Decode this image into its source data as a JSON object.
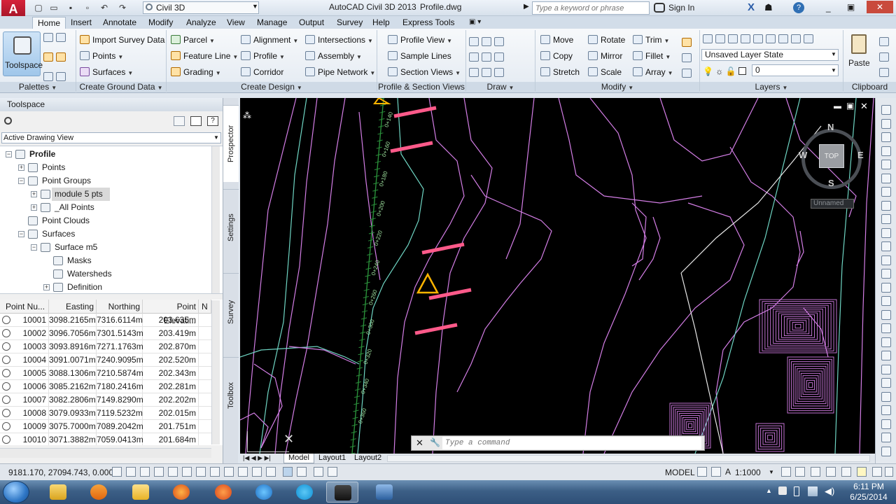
{
  "titlebar": {
    "workspace": "Civil 3D",
    "app_title": "AutoCAD Civil 3D 2013",
    "document": "Profile.dwg",
    "search_placeholder": "Type a keyword or phrase",
    "sign_in": "Sign In"
  },
  "ribbon": {
    "tabs": [
      "Home",
      "Insert",
      "Annotate",
      "Modify",
      "Analyze",
      "View",
      "Manage",
      "Output",
      "Survey",
      "Help",
      "Express Tools"
    ],
    "active_tab": "Home",
    "palettes": {
      "title": "Palettes",
      "toolspace": "Toolspace"
    },
    "ground": {
      "title": "Create Ground Data",
      "import": "Import Survey Data",
      "points": "Points",
      "surfaces": "Surfaces"
    },
    "design": {
      "title": "Create Design",
      "parcel": "Parcel",
      "feature_line": "Feature Line",
      "grading": "Grading",
      "alignment": "Alignment",
      "profile": "Profile",
      "corridor": "Corridor",
      "intersections": "Intersections",
      "assembly": "Assembly",
      "pipe_network": "Pipe Network"
    },
    "profile_section": {
      "title": "Profile & Section Views",
      "profile_view": "Profile View",
      "sample_lines": "Sample Lines",
      "section_views": "Section Views"
    },
    "draw": {
      "title": "Draw"
    },
    "modify": {
      "title": "Modify",
      "move": "Move",
      "copy": "Copy",
      "stretch": "Stretch",
      "rotate": "Rotate",
      "mirror": "Mirror",
      "scale": "Scale",
      "trim": "Trim",
      "fillet": "Fillet",
      "array": "Array"
    },
    "layers": {
      "title": "Layers",
      "layer_state": "Unsaved Layer State",
      "current_layer": "0"
    },
    "clipboard": {
      "title": "Clipboard",
      "paste": "Paste"
    }
  },
  "toolspace": {
    "title": "Toolspace",
    "view": "Active Drawing View",
    "side_tabs": [
      "Prospector",
      "Settings",
      "Survey",
      "Toolbox"
    ],
    "tree": [
      {
        "label": "Profile",
        "level": 0,
        "exp": "−",
        "bold": true
      },
      {
        "label": "Points",
        "level": 1,
        "exp": "+"
      },
      {
        "label": "Point Groups",
        "level": 1,
        "exp": "−"
      },
      {
        "label": "module 5 pts",
        "level": 2,
        "exp": "+",
        "selected": true
      },
      {
        "label": "_All Points",
        "level": 2,
        "exp": "+"
      },
      {
        "label": "Point Clouds",
        "level": 1,
        "exp": ""
      },
      {
        "label": "Surfaces",
        "level": 1,
        "exp": "−"
      },
      {
        "label": "Surface m5",
        "level": 2,
        "exp": "−"
      },
      {
        "label": "Masks",
        "level": 3,
        "exp": ""
      },
      {
        "label": "Watersheds",
        "level": 3,
        "exp": ""
      },
      {
        "label": "Definition",
        "level": 3,
        "exp": "+"
      }
    ],
    "grid": {
      "columns": [
        "Point Nu...",
        "Easting",
        "Northing",
        "Point Elevati...",
        "N"
      ],
      "rows": [
        [
          "10001",
          "3098.2165m",
          "7316.6114m",
          "203.635m"
        ],
        [
          "10002",
          "3096.7056m",
          "7301.5143m",
          "203.419m"
        ],
        [
          "10003",
          "3093.8916m",
          "7271.1763m",
          "202.870m"
        ],
        [
          "10004",
          "3091.0071m",
          "7240.9095m",
          "202.520m"
        ],
        [
          "10005",
          "3088.1306m",
          "7210.5874m",
          "202.343m"
        ],
        [
          "10006",
          "3085.2162m",
          "7180.2416m",
          "202.281m"
        ],
        [
          "10007",
          "3082.2806m",
          "7149.8290m",
          "202.202m"
        ],
        [
          "10008",
          "3079.0933m",
          "7119.5232m",
          "202.015m"
        ],
        [
          "10009",
          "3075.7000m",
          "7089.2042m",
          "201.751m"
        ],
        [
          "10010",
          "3071.3882m",
          "7059.0413m",
          "201.684m"
        ]
      ]
    }
  },
  "viewcube": {
    "n": "N",
    "s": "S",
    "e": "E",
    "w": "W",
    "top": "TOP",
    "ucs": "Unnamed"
  },
  "canvas": {
    "stations": [
      "0+140",
      "0+160",
      "0+180",
      "0+200",
      "0+220",
      "0+240",
      "0+260",
      "0+300",
      "0+320",
      "0+340",
      "0+360"
    ],
    "colors": {
      "contour": "#d47ee6",
      "minor": "#6fd6c4",
      "alignment": "#2a8f3a",
      "label": "#ff5a8a",
      "marker": "#ffb400"
    }
  },
  "command": {
    "placeholder": "Type a command"
  },
  "layout_tabs": [
    "Model",
    "Layout1",
    "Layout2"
  ],
  "statusbar": {
    "coords": "9181.170, 27094.743, 0.000",
    "model": "MODEL",
    "scale": "1:1000"
  },
  "taskbar": {
    "time": "6:11 PM",
    "date": "6/25/2014"
  }
}
